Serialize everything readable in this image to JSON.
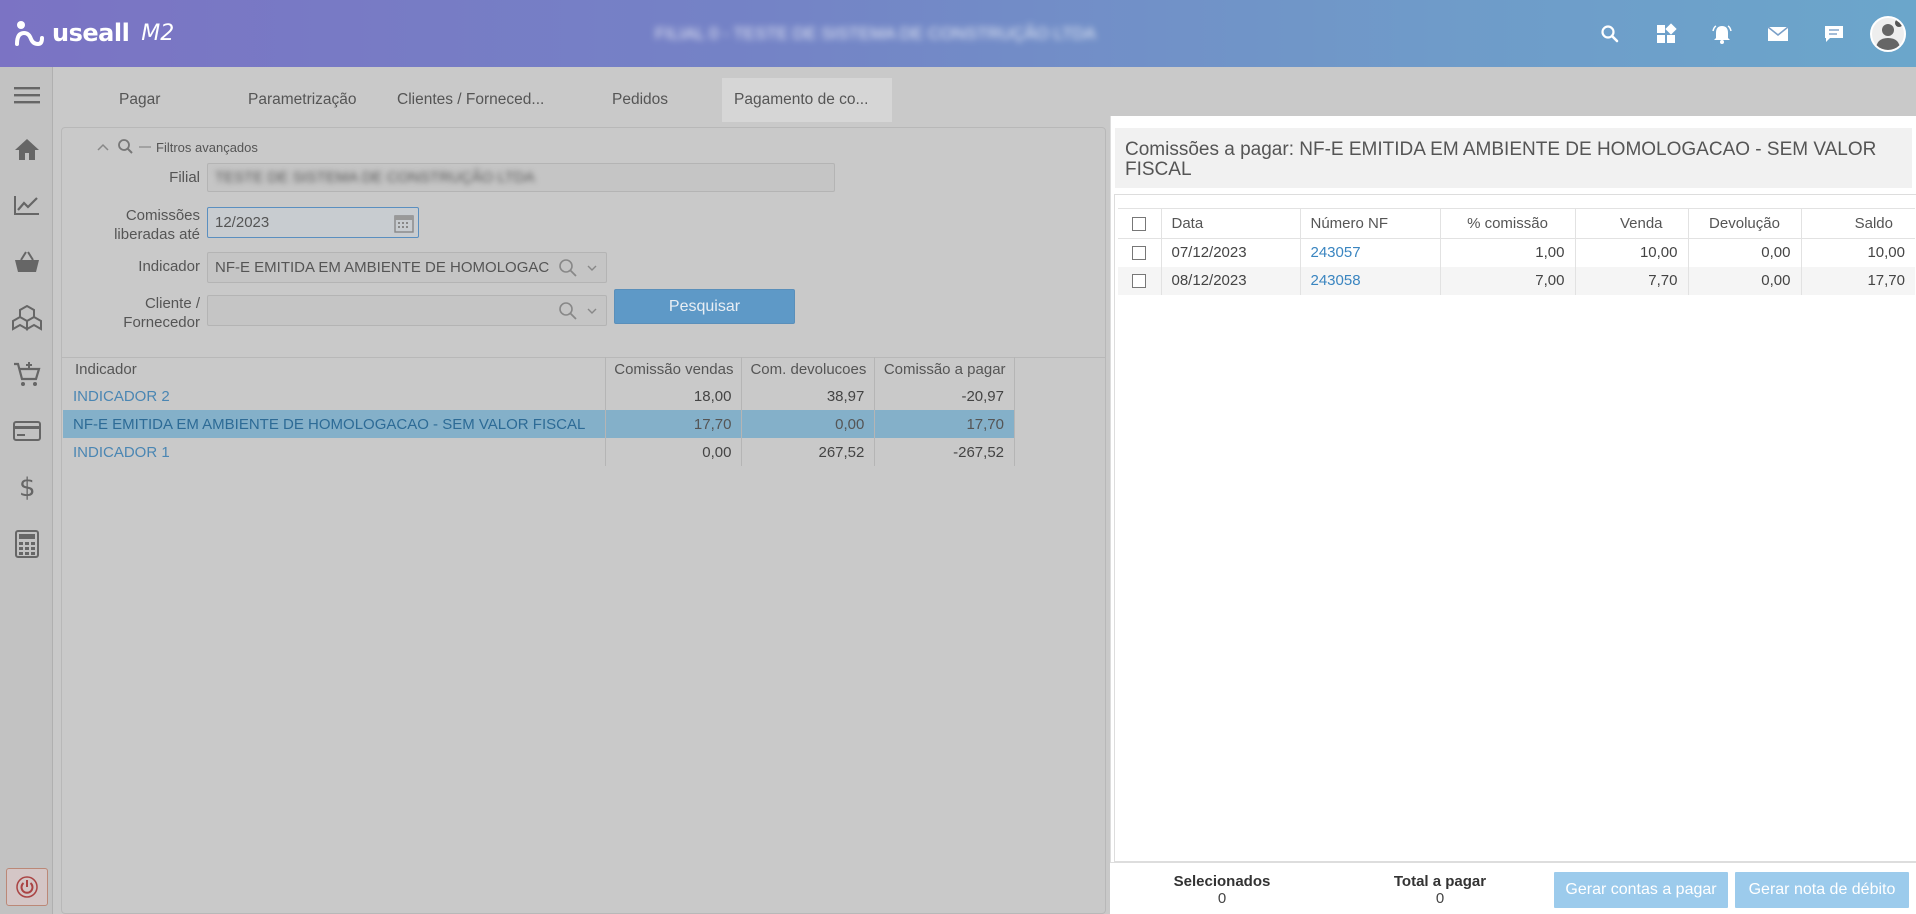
{
  "header": {
    "logo_text": "useall",
    "logo_version": "M2",
    "company_name": "FILIAL 0 - TESTE DE SISTEMA DE CONSTRUÇÃO LTDA"
  },
  "tabs": [
    {
      "label": "Pagar"
    },
    {
      "label": "Parametrização"
    },
    {
      "label": "Clientes / Forneced..."
    },
    {
      "label": "Pedidos"
    },
    {
      "label": "Pagamento de co..."
    }
  ],
  "filters": {
    "advanced_label": "Filtros avançados",
    "filial_label": "Filial",
    "filial_value": "TESTE DE SISTEMA DE CONSTRUÇÃO LTDA",
    "comissoes_label_line1": "Comissões",
    "comissoes_label_line2": "liberadas até",
    "comissoes_value": "12/2023",
    "indicador_label": "Indicador",
    "indicador_value": "NF-E EMITIDA EM AMBIENTE DE HOMOLOGAC",
    "cliente_label_line1": "Cliente /",
    "cliente_label_line2": "Fornecedor",
    "cliente_value": "",
    "search_button": "Pesquisar"
  },
  "indicator_table": {
    "columns": [
      "Indicador",
      "Comissão vendas",
      "Com. devolucoes",
      "Comissão a pagar"
    ],
    "rows": [
      {
        "indicador": "INDICADOR 2",
        "vendas": "18,00",
        "devolucoes": "38,97",
        "a_pagar": "-20,97"
      },
      {
        "indicador": "NF-E EMITIDA EM AMBIENTE DE HOMOLOGACAO - SEM VALOR FISCAL",
        "vendas": "17,70",
        "devolucoes": "0,00",
        "a_pagar": "17,70"
      },
      {
        "indicador": "INDICADOR 1",
        "vendas": "0,00",
        "devolucoes": "267,52",
        "a_pagar": "-267,52"
      }
    ]
  },
  "modal": {
    "title": "Comissões a pagar: NF-E EMITIDA EM AMBIENTE DE HOMOLOGACAO - SEM VALOR FISCAL",
    "columns": [
      "Data",
      "Número NF",
      "% comissão",
      "Venda",
      "Devolução",
      "Saldo"
    ],
    "rows": [
      {
        "data": "07/12/2023",
        "nf": "243057",
        "comissao": "1,00",
        "venda": "10,00",
        "devolucao": "0,00",
        "saldo": "10,00"
      },
      {
        "data": "08/12/2023",
        "nf": "243058",
        "comissao": "7,00",
        "venda": "7,70",
        "devolucao": "0,00",
        "saldo": "17,70"
      }
    ],
    "footer": {
      "selecionados_label": "Selecionados",
      "selecionados_value": "0",
      "total_label": "Total a pagar",
      "total_value": "0",
      "btn_contas": "Gerar contas a pagar",
      "btn_nota": "Gerar nota de débito"
    }
  },
  "colors": {
    "accent": "#5e99c7",
    "link": "#3a85c0",
    "selected_row": "#84b0c9"
  }
}
